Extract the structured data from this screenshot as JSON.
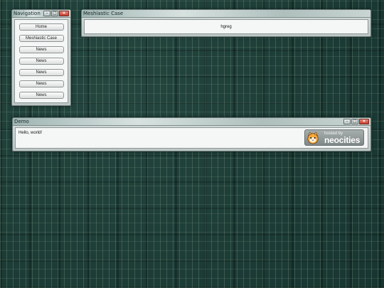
{
  "navigation_window": {
    "title": "Navigation",
    "controls": {
      "minimize_icon": "minimize-icon",
      "maximize_icon": "maximize-icon",
      "close_icon": "close-icon"
    },
    "items": [
      {
        "label": "Home"
      },
      {
        "label": "Meshiastic Case"
      },
      {
        "label": "News"
      },
      {
        "label": "News"
      },
      {
        "label": "News"
      },
      {
        "label": "News"
      },
      {
        "label": "News"
      }
    ]
  },
  "main_window": {
    "title": "Meshiastic Case",
    "content": "hgreg"
  },
  "demo_window": {
    "title": "Demo",
    "content": "Hello, world!",
    "badge": {
      "small_text": "hosted by",
      "large_text": "neocities",
      "icon": "neocities-cat-icon"
    }
  },
  "colors": {
    "desktop": "#1f3f3a",
    "close_button": "#c0392b",
    "window_body": "#f5f6f6"
  }
}
